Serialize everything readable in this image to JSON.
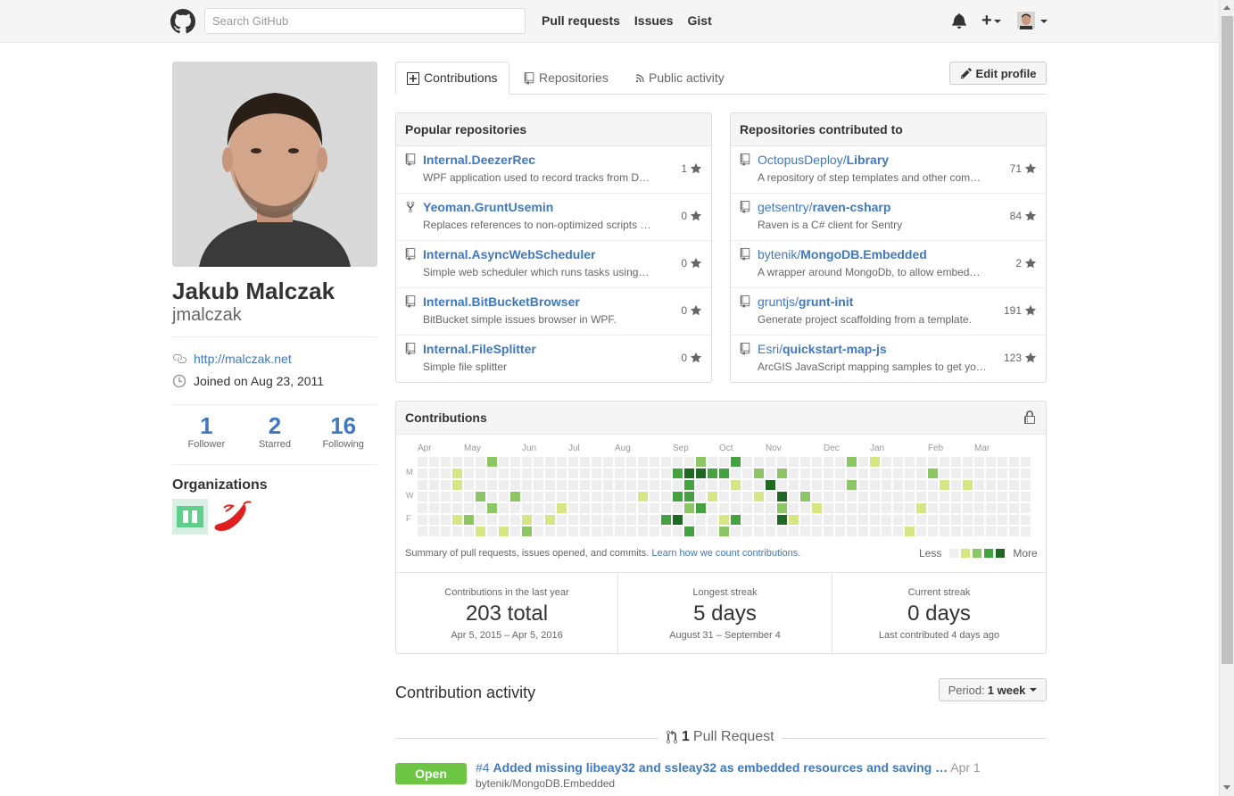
{
  "header": {
    "search_placeholder": "Search GitHub",
    "nav": [
      "Pull requests",
      "Issues",
      "Gist"
    ],
    "plus_label": "+"
  },
  "profile": {
    "full_name": "Jakub Malczak",
    "username": "jmalczak",
    "website": "http://malczak.net",
    "joined": "Joined on Aug 23, 2011",
    "stats": [
      {
        "num": "1",
        "label": "Follower"
      },
      {
        "num": "2",
        "label": "Starred"
      },
      {
        "num": "16",
        "label": "Following"
      }
    ],
    "organizations_title": "Organizations"
  },
  "tabs": {
    "contributions": "Contributions",
    "repositories": "Repositories",
    "public_activity": "Public activity",
    "edit_profile": "Edit profile"
  },
  "popular": {
    "title": "Popular repositories",
    "repos": [
      {
        "icon": "repo-icon",
        "name": "Internal.DeezerRec",
        "desc": "WPF application used to record tracks from D…",
        "stars": "1"
      },
      {
        "icon": "fork-icon",
        "name": "Yeoman.GruntUsemin",
        "desc": "Replaces references to non-optimized scripts …",
        "stars": "0"
      },
      {
        "icon": "repo-icon",
        "name": "Internal.AsyncWebScheduler",
        "desc": "Simple web scheduler which runs tasks using…",
        "stars": "0"
      },
      {
        "icon": "repo-icon",
        "name": "Internal.BitBucketBrowser",
        "desc": "BitBucket simple issues browser in WPF.",
        "stars": "0"
      },
      {
        "icon": "repo-icon",
        "name": "Internal.FileSplitter",
        "desc": "Simple file splitter",
        "stars": "0"
      }
    ]
  },
  "contributed": {
    "title": "Repositories contributed to",
    "repos": [
      {
        "owner": "OctopusDeploy/",
        "name": "Library",
        "desc": "A repository of step templates and other comm…",
        "stars": "71"
      },
      {
        "owner": "getsentry/",
        "name": "raven-csharp",
        "desc": "Raven is a C# client for Sentry",
        "stars": "84"
      },
      {
        "owner": "bytenik/",
        "name": "MongoDB.Embedded",
        "desc": "A wrapper around MongoDb, to allow embed…",
        "stars": "2"
      },
      {
        "owner": "gruntjs/",
        "name": "grunt-init",
        "desc": "Generate project scaffolding from a template.",
        "stars": "191"
      },
      {
        "owner": "Esri/",
        "name": "quickstart-map-js",
        "desc": "ArcGIS JavaScript mapping samples to get yo…",
        "stars": "123"
      }
    ]
  },
  "contributions": {
    "title": "Contributions",
    "months": [
      "Apr",
      "May",
      "Jun",
      "Jul",
      "Aug",
      "Sep",
      "Oct",
      "Nov",
      "Dec",
      "Jan",
      "Feb",
      "Mar"
    ],
    "days": [
      "M",
      "W",
      "F"
    ],
    "summary": "Summary of pull requests, issues opened, and commits.",
    "summary_link": "Learn how we count contributions.",
    "legend_less": "Less",
    "legend_more": "More",
    "colors": [
      "#eeeeee",
      "#d6e685",
      "#8cc665",
      "#44a340",
      "#1e6823"
    ],
    "stats": [
      {
        "title": "Contributions in the last year",
        "big": "203 total",
        "sub": "Apr 5, 2015 – Apr 5, 2016"
      },
      {
        "title": "Longest streak",
        "big": "5 days",
        "sub": "August 31 – September 4"
      },
      {
        "title": "Current streak",
        "big": "0 days",
        "sub": "Last contributed 4 days ago"
      }
    ]
  },
  "activity": {
    "title": "Contribution activity",
    "period_label": "Period:",
    "period_value": "1 week",
    "pr_count": "1",
    "pr_label": "Pull Request",
    "pr": {
      "status": "Open",
      "number": "#4",
      "title": "Added missing libeay32 and ssleay32 as embedded resources and saving …",
      "date": "Apr 1",
      "repo": "bytenik/MongoDB.Embedded"
    }
  }
}
